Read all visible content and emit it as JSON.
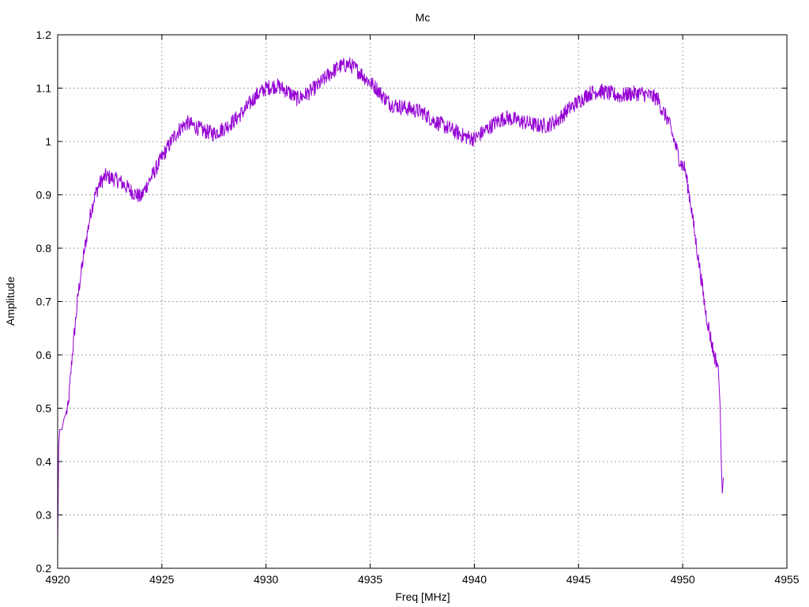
{
  "chart_data": {
    "type": "line",
    "title": "Mc",
    "xlabel": "Freq [MHz]",
    "ylabel": "Amplitude",
    "xlim": [
      4920,
      4955
    ],
    "ylim": [
      0.2,
      1.2
    ],
    "x_ticks": [
      "4920",
      "4925",
      "4930",
      "4935",
      "4940",
      "4945",
      "4950",
      "4955"
    ],
    "y_ticks": [
      "0.2",
      "0.3",
      "0.4",
      "0.5",
      "0.6",
      "0.7",
      "0.8",
      "0.9",
      "1",
      "1.1",
      "1.2"
    ],
    "grid": true,
    "series_color": "#9400d3",
    "series": [
      {
        "x": [
          4920.0,
          4920.05,
          4920.1,
          4920.2,
          4920.3,
          4920.5,
          4920.7,
          4921.0,
          4921.3,
          4921.6,
          4921.8,
          4922.0,
          4922.3,
          4922.7,
          4923.0,
          4923.3,
          4923.6,
          4924.0,
          4924.3,
          4924.6,
          4925.0,
          4925.3,
          4925.6,
          4925.9,
          4926.2,
          4926.5,
          4927.0,
          4927.5,
          4928.0,
          4928.5,
          4929.0,
          4929.5,
          4930.0,
          4930.5,
          4931.0,
          4931.5,
          4932.0,
          4932.5,
          4933.0,
          4933.5,
          4934.0,
          4934.5,
          4935.0,
          4935.3,
          4935.6,
          4936.0,
          4936.5,
          4937.0,
          4937.5,
          4938.0,
          4938.5,
          4939.0,
          4939.5,
          4940.0,
          4940.5,
          4941.0,
          4941.5,
          4942.0,
          4942.5,
          4943.0,
          4943.5,
          4944.0,
          4944.5,
          4945.0,
          4945.5,
          4946.0,
          4946.5,
          4947.0,
          4947.5,
          4948.0,
          4948.5,
          4948.8,
          4949.0,
          4949.3,
          4949.6,
          4949.9,
          4950.1,
          4950.4,
          4950.6,
          4950.9,
          4951.1,
          4951.3,
          4951.5,
          4951.7,
          4951.8,
          4951.85,
          4951.9,
          4951.95
        ],
        "y": [
          0.24,
          0.43,
          0.46,
          0.46,
          0.48,
          0.5,
          0.6,
          0.72,
          0.8,
          0.87,
          0.9,
          0.92,
          0.935,
          0.93,
          0.925,
          0.915,
          0.905,
          0.895,
          0.92,
          0.94,
          0.97,
          0.99,
          1.01,
          1.025,
          1.035,
          1.03,
          1.02,
          1.015,
          1.025,
          1.04,
          1.06,
          1.085,
          1.1,
          1.105,
          1.095,
          1.08,
          1.09,
          1.105,
          1.125,
          1.14,
          1.145,
          1.13,
          1.11,
          1.1,
          1.085,
          1.07,
          1.065,
          1.06,
          1.055,
          1.04,
          1.03,
          1.02,
          1.01,
          1.005,
          1.02,
          1.035,
          1.045,
          1.04,
          1.035,
          1.03,
          1.03,
          1.04,
          1.06,
          1.075,
          1.09,
          1.095,
          1.09,
          1.085,
          1.09,
          1.09,
          1.085,
          1.08,
          1.06,
          1.04,
          1.0,
          0.96,
          0.95,
          0.88,
          0.82,
          0.74,
          0.68,
          0.64,
          0.6,
          0.58,
          0.5,
          0.4,
          0.34,
          0.37
        ]
      }
    ]
  }
}
